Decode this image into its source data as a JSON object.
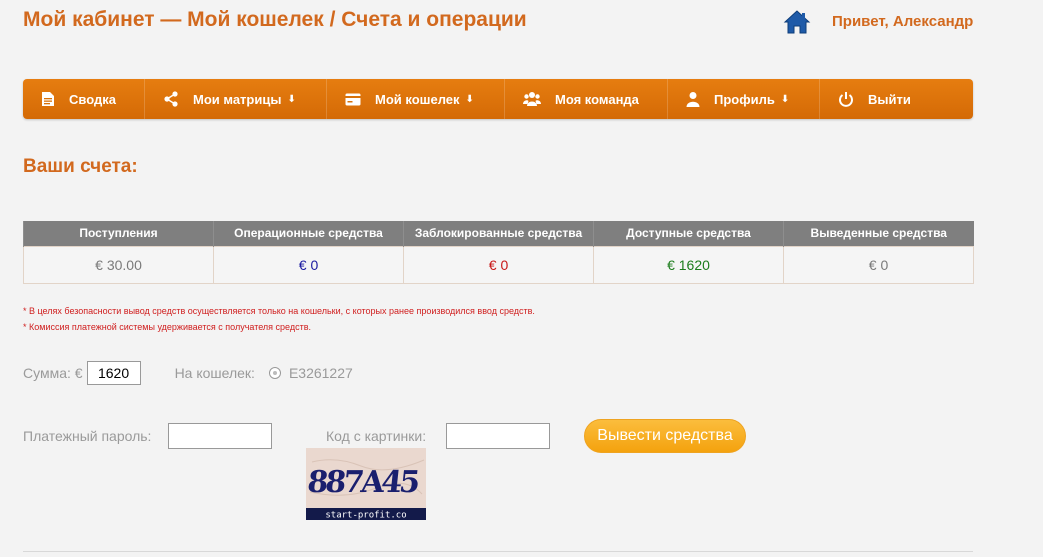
{
  "header": {
    "title": "Мой кабинет — Мой кошелек / Счета и операции",
    "greeting": "Привет, Александр"
  },
  "nav": {
    "items": [
      {
        "label": "Сводка",
        "icon": "document-icon",
        "dropdown": false
      },
      {
        "label": "Мои матрицы",
        "icon": "share-icon",
        "dropdown": true
      },
      {
        "label": "Мой кошелек",
        "icon": "wallet-icon",
        "dropdown": true
      },
      {
        "label": "Моя команда",
        "icon": "team-icon",
        "dropdown": false
      },
      {
        "label": "Профиль",
        "icon": "user-icon",
        "dropdown": true
      },
      {
        "label": "Выйти",
        "icon": "power-icon",
        "dropdown": false
      }
    ],
    "dropdown_arrow": "⬇"
  },
  "accounts": {
    "title": "Ваши счета:",
    "columns": [
      "Поступления",
      "Операционные средства",
      "Заблокированные средства",
      "Доступные средства",
      "Выведенные средства"
    ],
    "values": [
      "€ 30.00",
      "€ 0",
      "€ 0",
      "€ 1620",
      "€ 0"
    ]
  },
  "notes": [
    "* В целях безопасности вывод средств осуществляется только на кошельки, с которых ранее производился ввод средств.",
    "* Комиссия платежной системы удерживается с получателя средств."
  ],
  "form": {
    "amount_label": "Сумма: €",
    "amount_value": "1620",
    "wallet_label": "На кошелек:",
    "wallet_value": "E3261227",
    "password_label": "Платежный пароль:",
    "password_value": "",
    "captcha_label": "Код с картинки:",
    "captcha_value": "",
    "submit_label": "Вывести средства"
  },
  "captcha": {
    "text": "887A45",
    "caption": "start-profit.co"
  },
  "colors": {
    "accent": "#d2691e",
    "navbar": "#e07408",
    "button": "#f7aa1c"
  }
}
